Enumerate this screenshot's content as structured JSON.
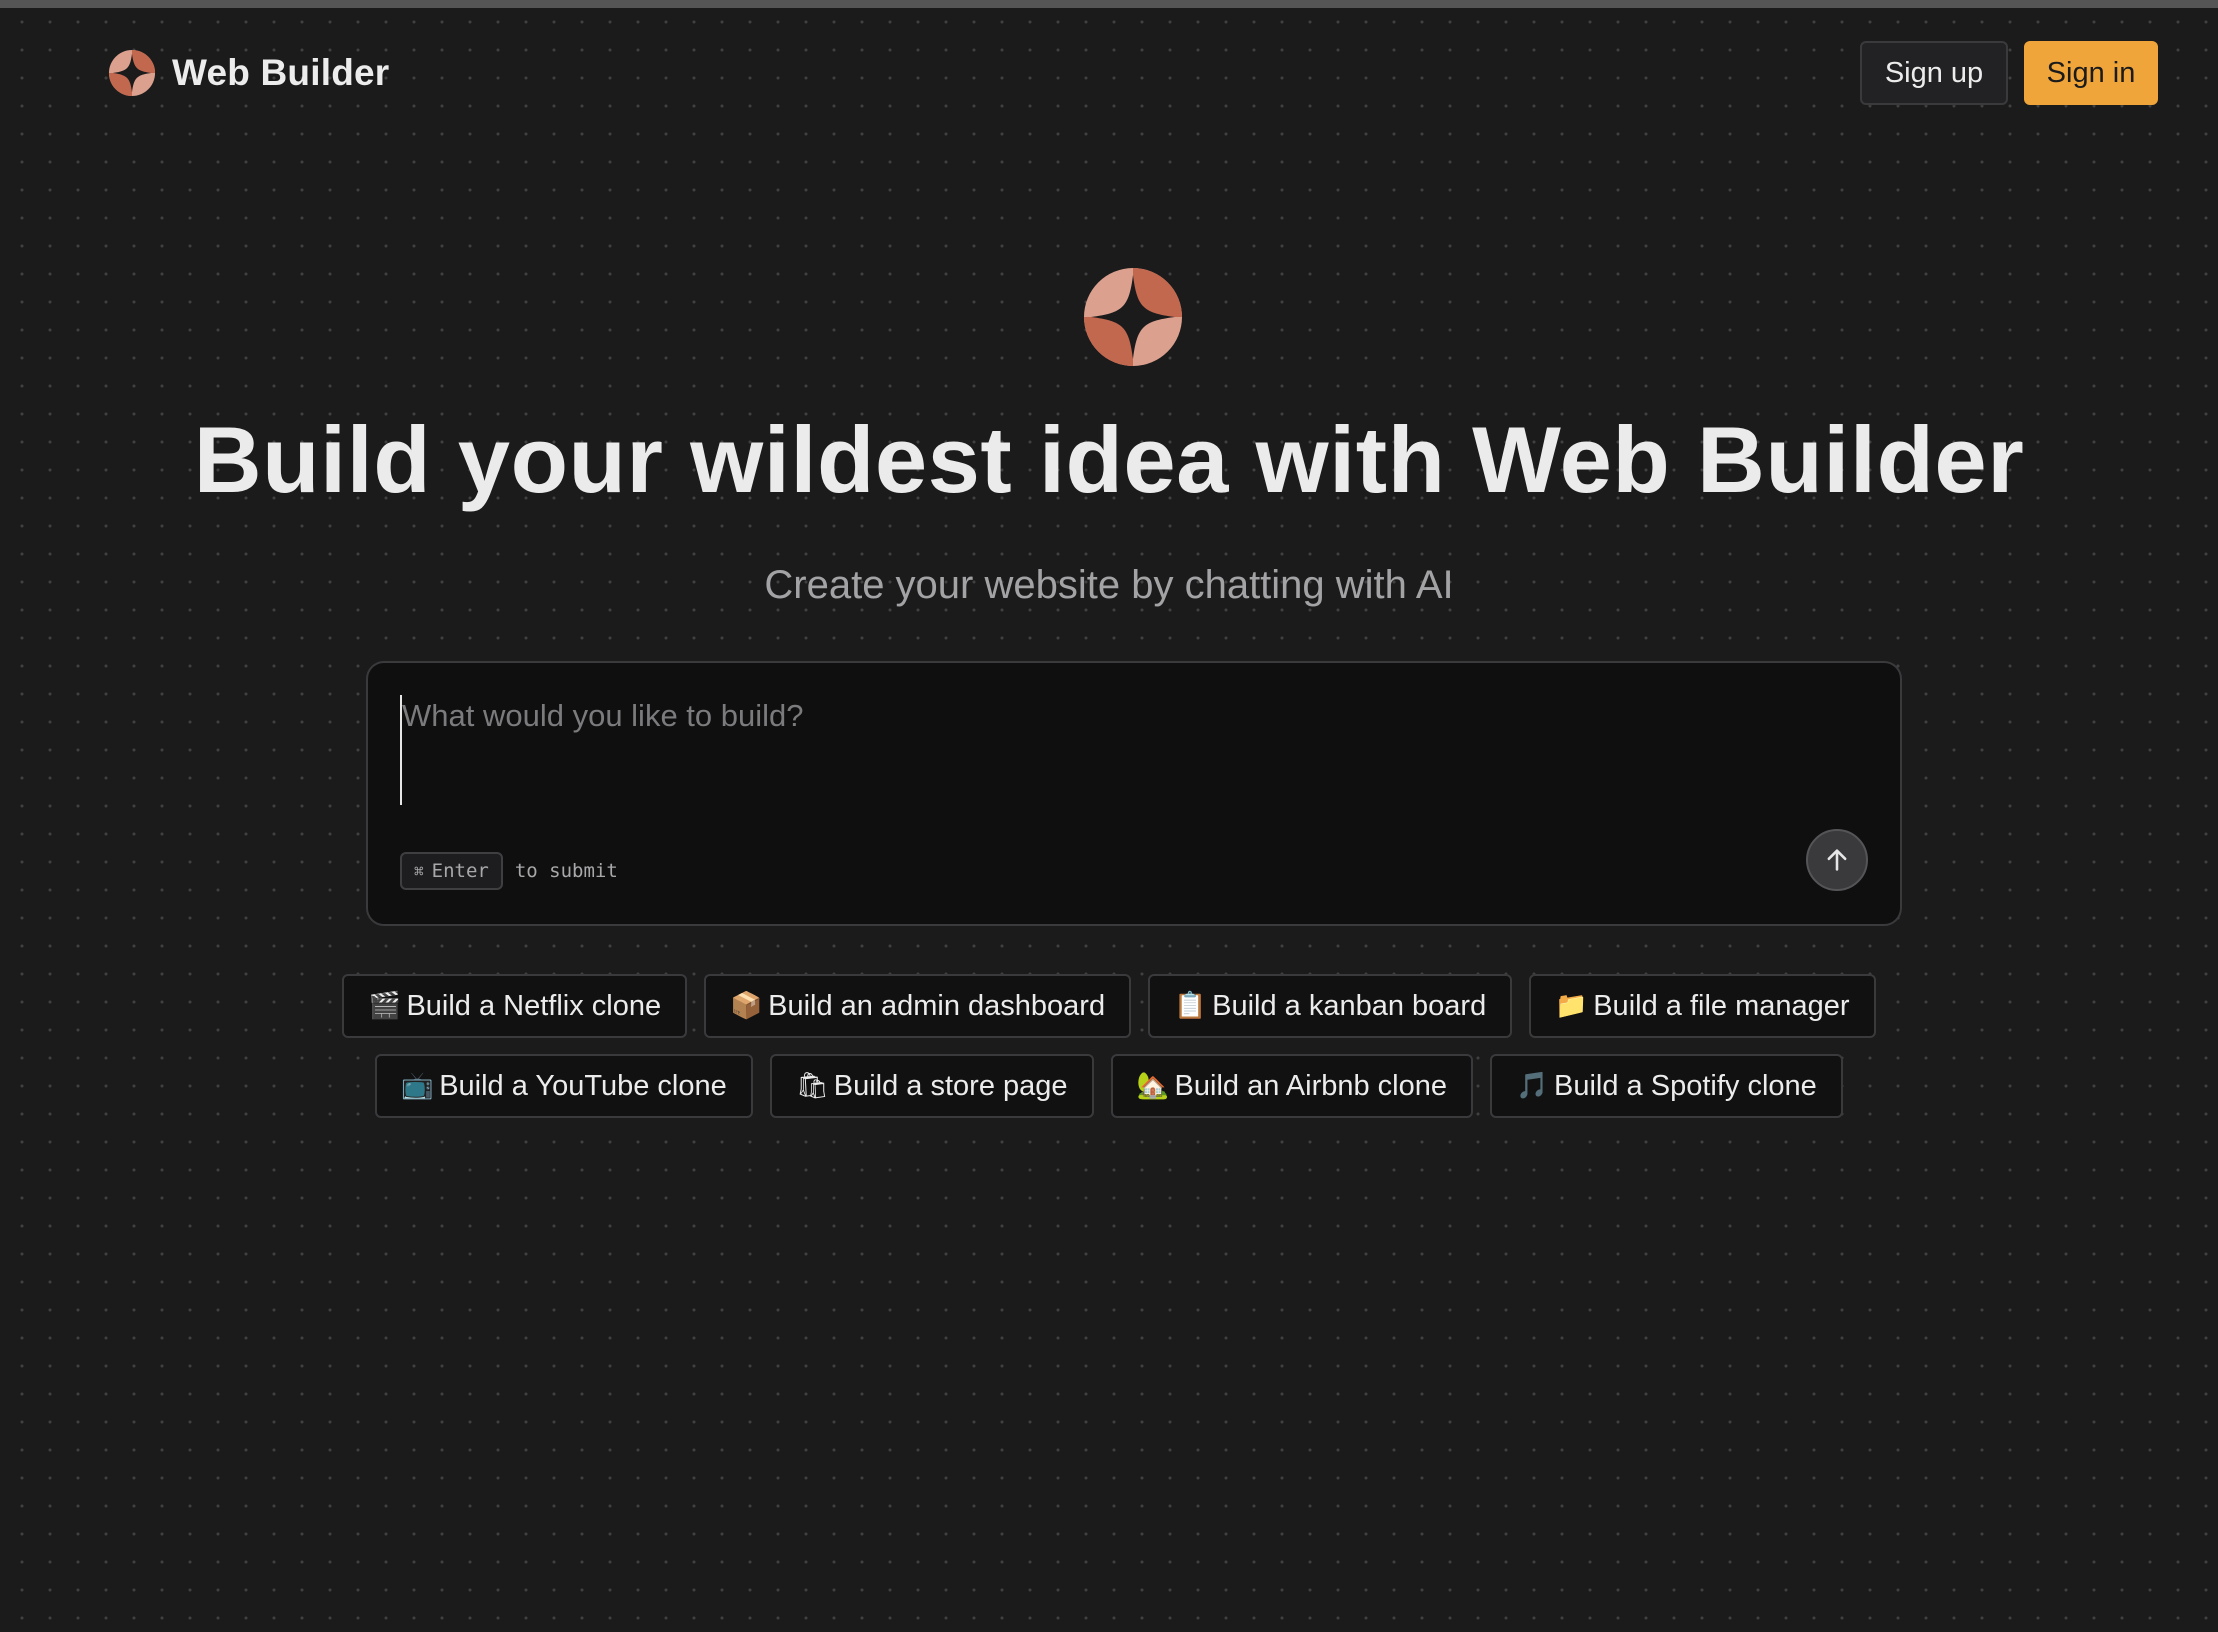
{
  "app": {
    "name": "Web Builder"
  },
  "header": {
    "signup_label": "Sign up",
    "signin_label": "Sign in"
  },
  "hero": {
    "title": "Build your wildest idea with Web Builder",
    "subtitle": "Create your website by chatting with AI"
  },
  "prompt": {
    "placeholder": "What would you like to build?",
    "value": "",
    "shortcut_symbol": "⌘",
    "shortcut_key": "Enter",
    "hint": "to submit"
  },
  "suggestions": [
    {
      "icon": "clapperboard-icon",
      "glyph": "🎬",
      "label": "Build a Netflix clone"
    },
    {
      "icon": "package-icon",
      "glyph": "📦",
      "label": "Build an admin dashboard"
    },
    {
      "icon": "clipboard-icon",
      "glyph": "📋",
      "label": "Build a kanban board"
    },
    {
      "icon": "folder-icon",
      "glyph": "📁",
      "label": "Build a file manager"
    },
    {
      "icon": "television-icon",
      "glyph": "📺",
      "label": "Build a YouTube clone"
    },
    {
      "icon": "shopping-bags-icon",
      "glyph": "🛍",
      "label": "Build a store page"
    },
    {
      "icon": "house-icon",
      "glyph": "🏡",
      "label": "Build an Airbnb clone"
    },
    {
      "icon": "music-note-icon",
      "glyph": "🎵",
      "label": "Build a Spotify clone"
    }
  ],
  "colors": {
    "background": "#1b1b1c",
    "accent": "#f0a53a",
    "logo_primary": "#c2684f",
    "logo_secondary": "#dca08f"
  }
}
